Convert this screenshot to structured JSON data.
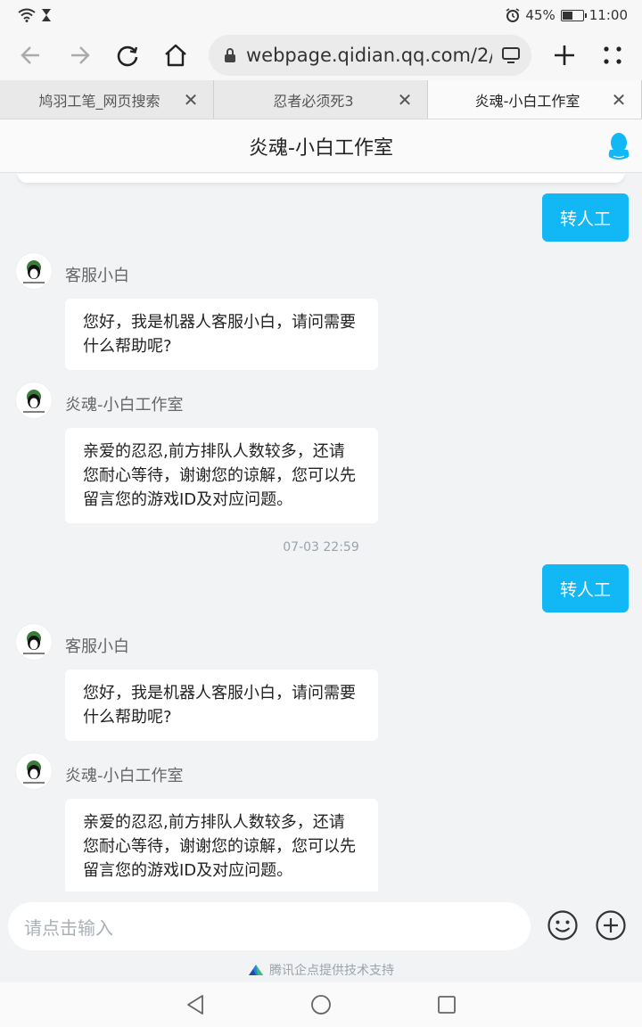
{
  "status_bar": {
    "battery": "45%",
    "battery_level": 0.45,
    "time": "11:00"
  },
  "browser": {
    "url": "webpage.qidian.qq.com/2/",
    "tabs": [
      {
        "title": "鸠羽工笔_网页搜索",
        "active": false
      },
      {
        "title": "忍者必须死3",
        "active": false
      },
      {
        "title": "炎魂-小白工作室",
        "active": true
      }
    ]
  },
  "header": {
    "title": "炎魂-小白工作室"
  },
  "messages": {
    "m1": {
      "text": "转人工"
    },
    "m2": {
      "sender": "客服小白",
      "text": "您好，我是机器人客服小白，请问需要什么帮助呢?"
    },
    "m3": {
      "sender": "炎魂-小白工作室",
      "text": "亲爱的忍忍,前方排队人数较多，还请您耐心等待，谢谢您的谅解，您可以先留言您的游戏ID及对应问题。"
    },
    "timestamp": "07-03 22:59",
    "m4": {
      "text": "转人工"
    },
    "m5": {
      "sender": "客服小白",
      "text": "您好，我是机器人客服小白，请问需要什么帮助呢?"
    },
    "m6": {
      "sender": "炎魂-小白工作室",
      "text": "亲爱的忍忍,前方排队人数较多，还请您耐心等待，谢谢您的谅解，您可以先留言您的游戏ID及对应问题。"
    }
  },
  "input": {
    "placeholder": "请点击输入"
  },
  "footer": {
    "powered_by": "腾讯企点提供技术支持"
  },
  "colors": {
    "accent": "#12b7f5",
    "qq_blue": "#12b7f5"
  }
}
